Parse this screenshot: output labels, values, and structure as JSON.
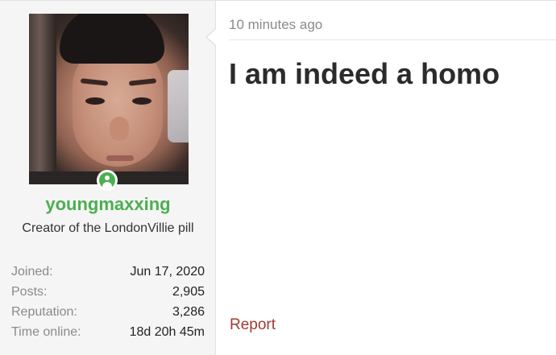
{
  "user": {
    "username": "youngmaxxing",
    "title": "Creator of the LondonVillie pill",
    "online_status": "online",
    "status_color": "#4caf50",
    "stats": [
      {
        "label": "Joined:",
        "value": "Jun 17, 2020"
      },
      {
        "label": "Posts:",
        "value": "2,905"
      },
      {
        "label": "Reputation:",
        "value": "3,286"
      },
      {
        "label": "Time online:",
        "value": "18d 20h 45m"
      }
    ]
  },
  "post": {
    "timestamp": "10 minutes ago",
    "body": "I am indeed a homo",
    "report_label": "Report"
  },
  "colors": {
    "username": "#4caf50",
    "report_link": "#a33a33",
    "sidebar_bg": "#f5f5f5"
  },
  "icons": {
    "status": "user-online-icon"
  }
}
